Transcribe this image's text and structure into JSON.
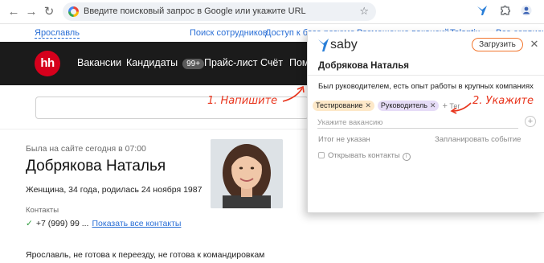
{
  "browser": {
    "address_placeholder": "Введите поисковый запрос в Google или укажите URL"
  },
  "topbar": {
    "region": "Ярославль",
    "links": [
      "Поиск сотрудников",
      "Доступ к базе резюме",
      "Размещение вакансий",
      "Talantix",
      "Все сервисы"
    ]
  },
  "header": {
    "logo": "hh",
    "nav": [
      "Вакансии",
      "Кандидаты",
      "Прайс-лист",
      "Счёт",
      "Пом"
    ],
    "candidates_badge": "99+"
  },
  "resume": {
    "last_seen": "Была на сайте сегодня в 07:00",
    "name": "Добрякова Наталья",
    "info": "Женщина, 34 года, родилась 24 ноября 1987",
    "contacts_title": "Контакты",
    "phone": "+7 (999) 99 ...",
    "show_contacts": "Показать все контакты",
    "relocation": "Ярославль, не готова к переезду, не готова к командировкам"
  },
  "popup": {
    "logo_text": "saby",
    "upload_button": "Загрузить",
    "candidate_name": "Добрякова Наталья",
    "description": "Был руководителем, есть опыт работы в крупных компаниях",
    "tags": [
      {
        "label": "Тестирование",
        "color": "#fde8c8"
      },
      {
        "label": "Руководитель",
        "color": "#e6dcf7"
      }
    ],
    "add_tag": "Тег",
    "vacancy_placeholder": "Укажите вакансию",
    "result": "Итог не указан",
    "schedule_event": "Запланировать событие",
    "open_contacts": "Открывать контакты"
  },
  "annotations": {
    "first": "1. Напишите",
    "second": "2. Укажите"
  },
  "colors": {
    "accent_orange": "#f2762e",
    "annotation_red": "#e8341c",
    "link_blue": "#2a6fd6",
    "hh_red": "#d6001c",
    "header_dark": "#1b1b1b"
  }
}
